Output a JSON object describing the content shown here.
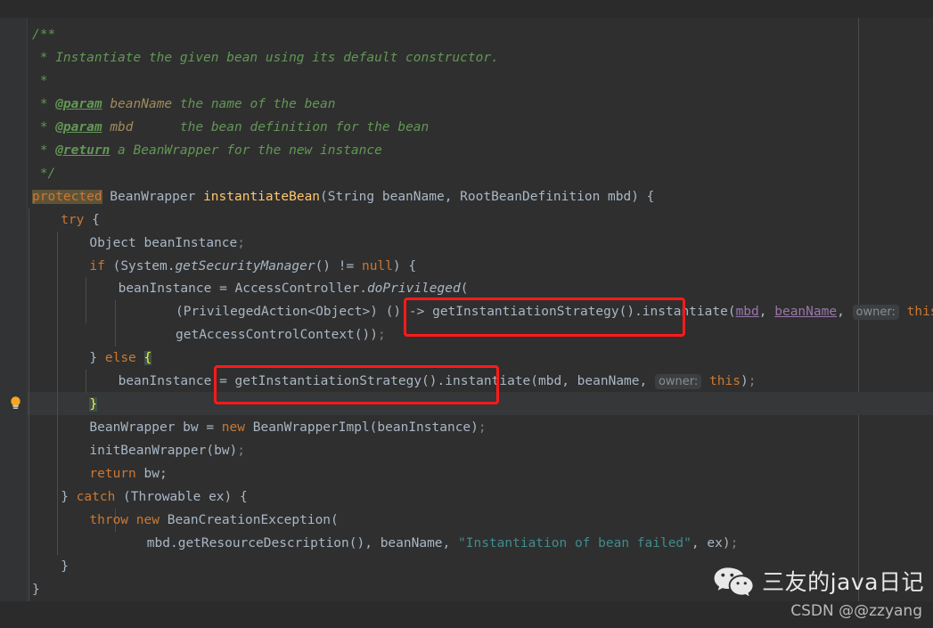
{
  "editor": {
    "app": "IntelliJ IDEA",
    "language": "Java",
    "theme": "Darcula",
    "colors": {
      "background": "#2f2f2f",
      "gutter": "#313335",
      "caret_line": "#353739",
      "keyword": "#cc7832",
      "identifier": "#a9b7c6",
      "method": "#ffc66d",
      "string": "#418b8b",
      "comment": "#629755",
      "javadoc_param": "#a08b5b",
      "lambda_capture": "#9876aa",
      "search_highlight_bg": "#5e5339",
      "brace_match_bg": "#3b514d",
      "brace_match_fg": "#ffef28",
      "inlay_hint_bg": "#3c3f41",
      "inlay_hint_fg": "#8c8c8c",
      "annotation_box": "#ff1a1a",
      "margin_guide": "#4b4b4b"
    }
  },
  "gutter": {
    "intention_icon": "lightbulb-icon",
    "fold_marker_glyph": "]"
  },
  "code": {
    "lines": [
      {
        "indent": 1,
        "tokens": [
          {
            "t": "/**",
            "c": "cmt"
          }
        ]
      },
      {
        "indent": 1,
        "tokens": [
          {
            "t": " * Instantiate the given bean using its default constructor.",
            "c": "cmt"
          }
        ]
      },
      {
        "indent": 1,
        "tokens": [
          {
            "t": " *",
            "c": "cmt"
          }
        ]
      },
      {
        "indent": 1,
        "tokens": [
          {
            "t": " * ",
            "c": "cmt"
          },
          {
            "t": "@param",
            "c": "cmt-tag"
          },
          {
            "t": " ",
            "c": "cmt"
          },
          {
            "t": "beanName",
            "c": "cmt-param"
          },
          {
            "t": " the name of the bean",
            "c": "cmt"
          }
        ]
      },
      {
        "indent": 1,
        "tokens": [
          {
            "t": " * ",
            "c": "cmt"
          },
          {
            "t": "@param",
            "c": "cmt-tag"
          },
          {
            "t": " ",
            "c": "cmt"
          },
          {
            "t": "mbd",
            "c": "cmt-param"
          },
          {
            "t": "      the bean definition for the bean",
            "c": "cmt"
          }
        ]
      },
      {
        "indent": 1,
        "tokens": [
          {
            "t": " * ",
            "c": "cmt"
          },
          {
            "t": "@return",
            "c": "cmt-tag"
          },
          {
            "t": " a BeanWrapper for the new instance",
            "c": "cmt"
          }
        ]
      },
      {
        "indent": 1,
        "tokens": [
          {
            "t": " */",
            "c": "cmt"
          }
        ]
      },
      {
        "indent": 1,
        "tokens": [
          {
            "t": "protected",
            "c": "searchhl"
          },
          {
            "t": " BeanWrapper ",
            "c": "plain"
          },
          {
            "t": "instantiateBean",
            "c": "method"
          },
          {
            "t": "(String beanName, RootBeanDefinition mbd) {",
            "c": "plain"
          }
        ]
      },
      {
        "indent": 2,
        "tokens": [
          {
            "t": "try",
            "c": "kw"
          },
          {
            "t": " {",
            "c": "plain"
          }
        ]
      },
      {
        "indent": 3,
        "tokens": [
          {
            "t": "Object beanInstance",
            "c": "plain"
          },
          {
            "t": ";",
            "c": "semi"
          }
        ]
      },
      {
        "indent": 3,
        "tokens": [
          {
            "t": "if",
            "c": "kw"
          },
          {
            "t": " (System.",
            "c": "plain"
          },
          {
            "t": "getSecurityManager",
            "c": "static-m"
          },
          {
            "t": "() != ",
            "c": "plain"
          },
          {
            "t": "null",
            "c": "kw"
          },
          {
            "t": ") {",
            "c": "plain"
          }
        ]
      },
      {
        "indent": 4,
        "tokens": [
          {
            "t": "beanInstance = AccessController.",
            "c": "plain"
          },
          {
            "t": "doPrivileged",
            "c": "static-m"
          },
          {
            "t": "(",
            "c": "plain"
          }
        ]
      },
      {
        "indent": 6,
        "tokens": [
          {
            "t": "(PrivilegedAction<Object>) () -> ",
            "c": "plain"
          },
          {
            "t": "getInstantiationStrategy().instantiate",
            "c": "plain"
          },
          {
            "t": "(",
            "c": "plain"
          },
          {
            "t": "mbd",
            "c": "lambda-v"
          },
          {
            "t": ", ",
            "c": "plain"
          },
          {
            "t": "beanName",
            "c": "lambda-v"
          },
          {
            "t": ", ",
            "c": "plain"
          },
          {
            "t": "owner:",
            "c": "hint"
          },
          {
            "t": " ",
            "c": "plain"
          },
          {
            "t": "this",
            "c": "kw"
          },
          {
            "t": "),",
            "c": "plain"
          }
        ]
      },
      {
        "indent": 6,
        "tokens": [
          {
            "t": "getAccessControlContext())",
            "c": "plain"
          },
          {
            "t": ";",
            "c": "semi"
          }
        ]
      },
      {
        "indent": 3,
        "tokens": [
          {
            "t": "} ",
            "c": "plain"
          },
          {
            "t": "else",
            "c": "kw"
          },
          {
            "t": " ",
            "c": "plain"
          },
          {
            "t": "{",
            "c": "bracehl"
          }
        ]
      },
      {
        "indent": 4,
        "tokens": [
          {
            "t": "beanInstance = ",
            "c": "plain"
          },
          {
            "t": "getInstantiationStrategy().instantiate",
            "c": "plain"
          },
          {
            "t": "(",
            "c": "plain"
          },
          {
            "t": "mbd, beanName, ",
            "c": "plain"
          },
          {
            "t": "owner:",
            "c": "hint"
          },
          {
            "t": " ",
            "c": "plain"
          },
          {
            "t": "this",
            "c": "kw"
          },
          {
            "t": ")",
            "c": "plain"
          },
          {
            "t": ";",
            "c": "semi"
          }
        ]
      },
      {
        "indent": 3,
        "tokens": [
          {
            "t": "}",
            "c": "bracehl"
          }
        ]
      },
      {
        "indent": 3,
        "tokens": [
          {
            "t": "BeanWrapper bw = ",
            "c": "plain"
          },
          {
            "t": "new",
            "c": "kw"
          },
          {
            "t": " BeanWrapperImpl(beanInstance)",
            "c": "plain"
          },
          {
            "t": ";",
            "c": "semi"
          }
        ]
      },
      {
        "indent": 3,
        "tokens": [
          {
            "t": "initBeanWrapper(bw)",
            "c": "plain"
          },
          {
            "t": ";",
            "c": "semi"
          }
        ]
      },
      {
        "indent": 3,
        "tokens": [
          {
            "t": "return",
            "c": "kw"
          },
          {
            "t": " bw;",
            "c": "plain"
          }
        ]
      },
      {
        "indent": 2,
        "tokens": [
          {
            "t": "} ",
            "c": "plain"
          },
          {
            "t": "catch",
            "c": "kw"
          },
          {
            "t": " (Throwable ex) {",
            "c": "plain"
          }
        ]
      },
      {
        "indent": 3,
        "tokens": [
          {
            "t": "throw",
            "c": "kw"
          },
          {
            "t": " ",
            "c": "plain"
          },
          {
            "t": "new",
            "c": "kw"
          },
          {
            "t": " BeanCreationException(",
            "c": "plain"
          }
        ]
      },
      {
        "indent": 5,
        "tokens": [
          {
            "t": "mbd.getResourceDescription(), beanName, ",
            "c": "plain"
          },
          {
            "t": "\"Instantiation of bean failed\"",
            "c": "str"
          },
          {
            "t": ", ex)",
            "c": "plain"
          },
          {
            "t": ";",
            "c": "semi"
          }
        ]
      },
      {
        "indent": 2,
        "tokens": [
          {
            "t": "}",
            "c": "plain"
          }
        ]
      },
      {
        "indent": 1,
        "tokens": [
          {
            "t": "}",
            "c": "plain"
          }
        ]
      }
    ]
  },
  "annotations": {
    "boxes": [
      {
        "id": "red-box-1",
        "label": "getInstantiationStrategy().instantiate"
      },
      {
        "id": "red-box-2",
        "label": "getInstantiationStrategy().instantiate"
      }
    ]
  },
  "watermark": {
    "icon": "wechat-logo-icon",
    "title": "三友的java日记",
    "subtitle": "CSDN @@zzyang"
  }
}
